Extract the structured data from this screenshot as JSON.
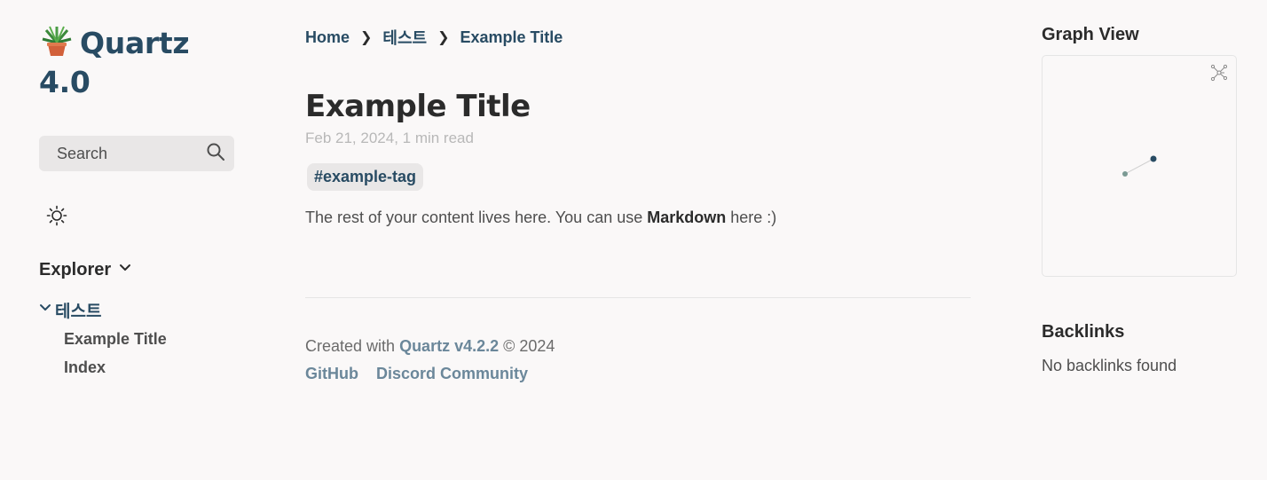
{
  "site": {
    "title_line1": "Quartz",
    "title_line2": "4.0",
    "logo_icon": "potted-plant-icon"
  },
  "search": {
    "label": "Search",
    "icon": "search-icon"
  },
  "theme_toggle": {
    "icon": "sun-icon"
  },
  "explorer": {
    "title": "Explorer",
    "folder": "테스트",
    "files": [
      "Example Title",
      "Index"
    ]
  },
  "breadcrumb": {
    "items": [
      "Home",
      "테스트",
      "Example Title"
    ],
    "separator": "❯"
  },
  "article": {
    "title": "Example Title",
    "meta": "Feb 21, 2024, 1 min read",
    "tag": "#example-tag",
    "body_prefix": "The rest of your content lives here. You can use ",
    "body_bold": "Markdown",
    "body_suffix": " here :)"
  },
  "footer": {
    "created_prefix": "Created with ",
    "quartz_link": "Quartz v4.2.2",
    "created_suffix": " © 2024",
    "links": [
      "GitHub",
      "Discord Community"
    ]
  },
  "graph": {
    "title": "Graph View",
    "expand_icon": "graph-expand-icon"
  },
  "backlinks": {
    "title": "Backlinks",
    "empty_text": "No backlinks found"
  },
  "colors": {
    "background": "#faf8f8",
    "primary": "#284b63",
    "secondary": "#6b879a",
    "text": "#4e4e4e",
    "heading": "#2b2b2b",
    "light_gray": "#e9e7e7"
  }
}
